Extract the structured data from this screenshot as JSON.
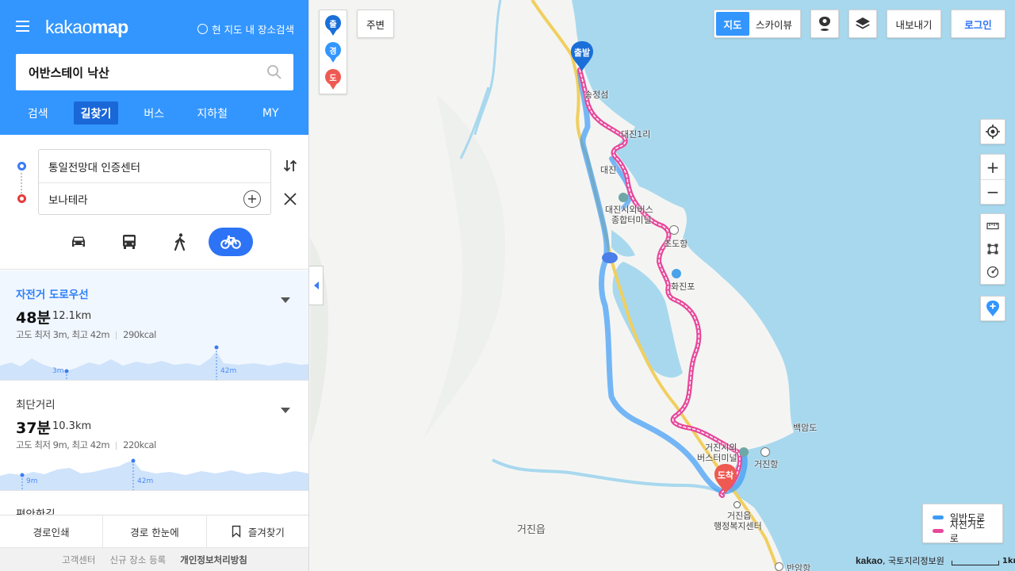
{
  "header": {
    "logo_light": "kakao",
    "logo_bold": "map",
    "map_search_toggle": "현 지도 내 장소검색"
  },
  "search": {
    "query": "어반스테이 낙산"
  },
  "tabs": [
    {
      "label": "검색",
      "active": false
    },
    {
      "label": "길찾기",
      "active": true
    },
    {
      "label": "버스",
      "active": false
    },
    {
      "label": "지하철",
      "active": false
    },
    {
      "label": "MY",
      "active": false
    }
  ],
  "route": {
    "origin": "통일전망대 인증센터",
    "destination": "보나테라",
    "modes": [
      "car-icon",
      "bus-icon",
      "walk-icon",
      "bicycle-icon"
    ],
    "active_mode": "bicycle"
  },
  "results": [
    {
      "name": "자전거 도로우선",
      "time": "48분",
      "distance": "12.1km",
      "elevation": "고도 최저 3m, 최고 42m",
      "calories": "290kcal",
      "min_label": "3m",
      "max_label": "42m",
      "selected": true
    },
    {
      "name": "최단거리",
      "time": "37분",
      "distance": "10.3km",
      "elevation": "고도 최저 9m, 최고 42m",
      "calories": "220kcal",
      "min_label": "9m",
      "max_label": "42m",
      "selected": false
    },
    {
      "name": "편안한길"
    }
  ],
  "bottom_actions": {
    "print": "경로인쇄",
    "overview": "경로 한눈에",
    "favorite": "즐겨찾기"
  },
  "footer": {
    "support": "고객센터",
    "register": "신규 장소 등록",
    "privacy": "개인정보처리방침"
  },
  "map": {
    "pins": {
      "start": "출",
      "waypoint": "경",
      "end": "도"
    },
    "nearby": "주변",
    "map_type": {
      "map": "지도",
      "skyview": "스카이뷰"
    },
    "export": "내보내기",
    "login": "로그인",
    "start_marker": "출발",
    "end_marker": "도착",
    "labels": {
      "l1": "송정섬",
      "l2": "대진1리",
      "l3": "대진",
      "l4": "대진시외버스",
      "l5": "종합터미널",
      "l6": "초도항",
      "l7": "화진포",
      "l8": "거진시외",
      "l9": "버스터미널",
      "l10": "거진항",
      "l11": "백암도",
      "l12": "거진읍",
      "l13": "행정복지센터",
      "l14": "거진읍",
      "l15": "반암항"
    },
    "legend": [
      {
        "label": "일반도로",
        "color": "#3d9bf5"
      },
      {
        "label": "자전거도로",
        "color": "#e7489b"
      }
    ],
    "copyright_brand": "kakao",
    "copyright_text": ", 국토지리정보원",
    "scale_label": "1km"
  },
  "colors": {
    "brand_blue": "#3396ff",
    "accent_blue": "#2d73f5",
    "bike_route": "#e7489b",
    "general_route": "#3d9bf5",
    "sea": "#a8d8ee"
  }
}
